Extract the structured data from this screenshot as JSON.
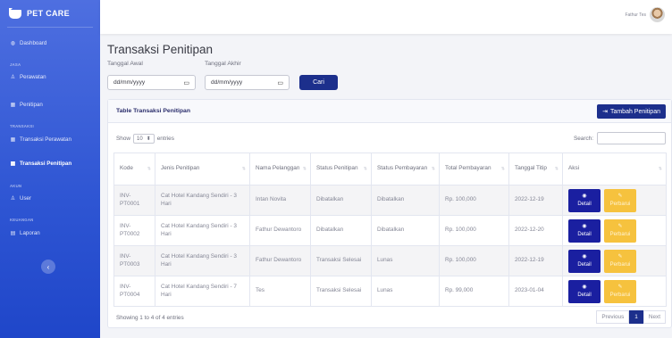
{
  "brand": {
    "name": "PET CARE"
  },
  "sidebar": {
    "dashboard": "Dashboard",
    "section_jasa": "JASA",
    "perawatan": "Perawatan",
    "penitipan": "Penitipan",
    "section_transaksi": "TRANSAKSI",
    "transaksi_perawatan": "Transaksi Perawatan",
    "transaksi_penitipan": "Transaksi Penitipan",
    "section_akun": "AKUN",
    "user": "User",
    "section_keuangan": "KEUANGAN",
    "laporan": "Laporan",
    "toggle_symbol": "‹"
  },
  "topbar": {
    "user_name": "Fathur Tes"
  },
  "page": {
    "title": "Transaksi Penitipan"
  },
  "filter": {
    "tanggal_awal_label": "Tanggal Awal",
    "tanggal_akhir_label": "Tanggal Akhir",
    "tanggal_awal_value": "dd/mm/yyyy",
    "tanggal_akhir_value": "dd/mm/yyyy",
    "cari_label": "Cari"
  },
  "card": {
    "title": "Table Transaksi Penitipan",
    "add_label": "Tambah Penitipan"
  },
  "table_controls": {
    "show_label": "Show",
    "entries_value": "10",
    "entries_label": "entries",
    "search_label": "Search:"
  },
  "table": {
    "headers": [
      "Kode",
      "Jenis Penitipan",
      "Nama Pelanggan",
      "Status Penitipan",
      "Status Pembayaran",
      "Total Pembayaran",
      "Tanggal Titip",
      "Aksi"
    ],
    "rows": [
      {
        "kode": "INV-PT0001",
        "jenis": "Cat Hotel Kandang Sendiri - 3 Hari",
        "nama": "Intan Novita",
        "status_penitipan": "Dibatalkan",
        "status_pembayaran": "Dibatalkan",
        "total": "Rp. 100,000",
        "tanggal": "2022-12-19"
      },
      {
        "kode": "INV-PT0002",
        "jenis": "Cat Hotel Kandang Sendiri - 3 Hari",
        "nama": "Fathur Dewantoro",
        "status_penitipan": "Dibatalkan",
        "status_pembayaran": "Dibatalkan",
        "total": "Rp. 100,000",
        "tanggal": "2022-12-20"
      },
      {
        "kode": "INV-PT0003",
        "jenis": "Cat Hotel Kandang Sendiri - 3 Hari",
        "nama": "Fathur Dewantoro",
        "status_penitipan": "Transaksi Selesai",
        "status_pembayaran": "Lunas",
        "total": "Rp. 100,000",
        "tanggal": "2022-12-19"
      },
      {
        "kode": "INV-PT0004",
        "jenis": "Cat Hotel Kandang Sendiri - 7 Hari",
        "nama": "Tes",
        "status_penitipan": "Transaksi Selesai",
        "status_pembayaran": "Lunas",
        "total": "Rp. 99,000",
        "tanggal": "2023-01-04"
      }
    ],
    "detail_label": "Detail",
    "perbarui_label": "Perbarui"
  },
  "footer": {
    "info": "Showing 1 to 4 of 4 entries",
    "previous": "Previous",
    "current": "1",
    "next": "Next"
  },
  "colors": {
    "sidebar": "#2e55d3",
    "primary_button": "#1c2f8c",
    "detail_button": "#1a1fa0",
    "perbarui_button": "#f6c23e"
  }
}
